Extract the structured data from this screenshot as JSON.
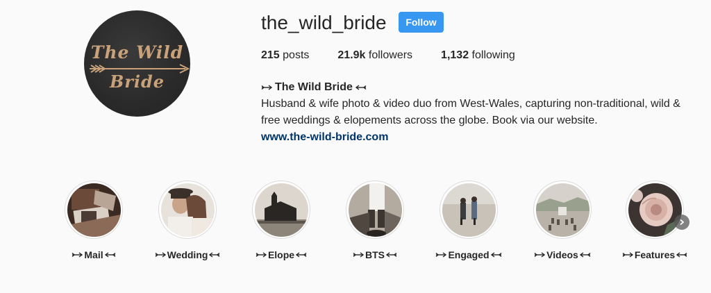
{
  "profile": {
    "username": "the_wild_bride",
    "follow_label": "Follow",
    "avatar_text_line1": "The Wild",
    "avatar_text_line2": "Bride",
    "stats": {
      "posts_count": "215",
      "posts_label": "posts",
      "followers_count": "21.9k",
      "followers_label": "followers",
      "following_count": "1,132",
      "following_label": "following"
    },
    "bio": {
      "name": "The Wild Bride",
      "text": "Husband & wife photo & video duo from West-Wales, capturing non-traditional, wild & free weddings & elopements across the globe. Book via our website.",
      "link": "www.the-wild-bride.com"
    }
  },
  "highlights": [
    {
      "label": "Mail",
      "icon": "mail-photo"
    },
    {
      "label": "Wedding",
      "icon": "couple-photo"
    },
    {
      "label": "Elope",
      "icon": "church-photo"
    },
    {
      "label": "BTS",
      "icon": "behind-the-scenes-photo"
    },
    {
      "label": "Engaged",
      "icon": "beach-couple-photo"
    },
    {
      "label": "Videos",
      "icon": "ceremony-photo"
    },
    {
      "label": "Features",
      "icon": "rose-photo"
    }
  ],
  "colors": {
    "accent": "#3897f0",
    "link": "#003569",
    "background": "#fafafa",
    "text": "#262626"
  },
  "icons": {
    "decor_arrow": "arrow-icon",
    "next": "chevron-right-icon"
  }
}
